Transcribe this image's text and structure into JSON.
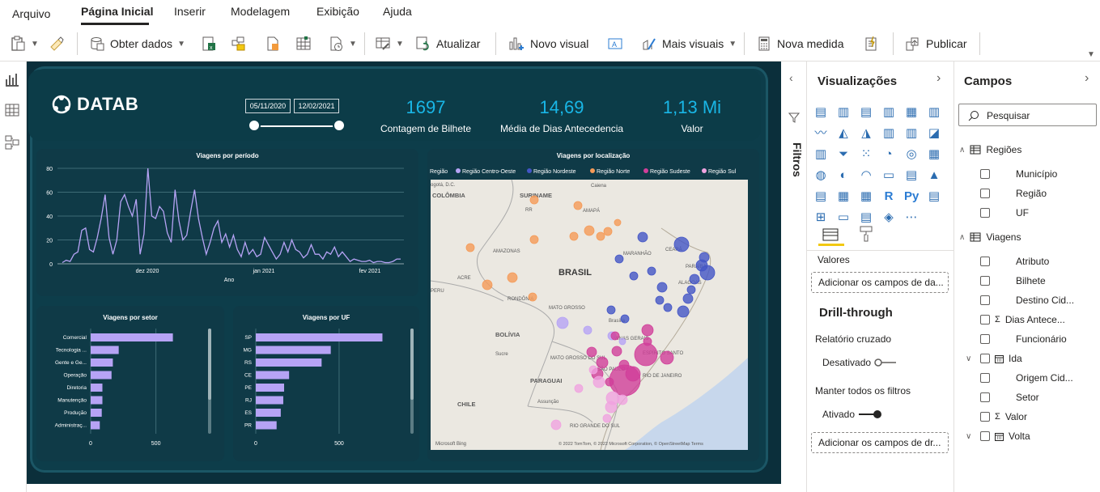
{
  "menu": {
    "items": [
      "Arquivo",
      "Página Inicial",
      "Inserir",
      "Modelagem",
      "Exibição",
      "Ajuda"
    ]
  },
  "ribbon": {
    "obter_dados": "Obter dados",
    "atualizar": "Atualizar",
    "novo_visual": "Novo visual",
    "mais_visuais": "Mais visuais",
    "nova_medida": "Nova medida",
    "publicar": "Publicar"
  },
  "report": {
    "logo": "DATAB",
    "date_start": "05/11/2020",
    "date_end": "12/02/2021",
    "kpis": [
      {
        "value": "1697",
        "label": "Contagem de Bilhete"
      },
      {
        "value": "14,69",
        "label": "Média de Dias Antecedencia"
      },
      {
        "value": "1,13 Mi",
        "label": "Valor"
      }
    ]
  },
  "chart_data": [
    {
      "type": "line",
      "title": "Viagens por período",
      "xlabel": "Ano",
      "ylabel": "",
      "ylim": [
        0,
        80
      ],
      "yticks": [
        0,
        20,
        40,
        60,
        80
      ],
      "xticks": [
        "dez 2020",
        "jan 2021",
        "fev 2021"
      ],
      "series": [
        {
          "values": [
            1,
            3,
            2,
            8,
            10,
            28,
            30,
            12,
            10,
            22,
            38,
            58,
            22,
            8,
            20,
            52,
            58,
            48,
            40,
            54,
            8,
            25,
            80,
            40,
            38,
            48,
            44,
            26,
            18,
            62,
            36,
            20,
            24,
            44,
            62,
            38,
            22,
            8,
            18,
            30,
            36,
            18,
            25,
            14,
            24,
            12,
            6,
            18,
            8,
            12,
            6,
            8,
            22,
            16,
            10,
            4,
            8,
            18,
            10,
            20,
            12,
            10,
            5,
            8,
            16,
            8,
            8,
            4,
            10,
            8,
            14,
            6,
            10,
            6,
            2,
            4,
            3,
            2,
            2,
            3,
            1,
            2,
            2,
            1,
            1,
            2,
            4,
            4
          ]
        }
      ],
      "color": "#b6a3f5"
    },
    {
      "type": "bar",
      "title": "Viagens por setor",
      "categories": [
        "Comercial",
        "Tecnologia ...",
        "Gente e Ge...",
        "Operação",
        "Diretoria",
        "Manutenção",
        "Produção",
        "Administraç..."
      ],
      "values": [
        630,
        215,
        170,
        160,
        90,
        90,
        85,
        70
      ],
      "xlim": [
        0,
        800
      ],
      "xticks": [
        0,
        500
      ],
      "color": "#b6a3f5"
    },
    {
      "type": "bar",
      "title": "Viagens por UF",
      "categories": [
        "SP",
        "MG",
        "RS",
        "CE",
        "PE",
        "RJ",
        "ES",
        "PR"
      ],
      "values": [
        760,
        450,
        395,
        200,
        170,
        165,
        150,
        125
      ],
      "xlim": [
        0,
        850
      ],
      "xticks": [
        0,
        500
      ],
      "color": "#b6a3f5"
    },
    {
      "type": "scatter",
      "title": "Viagens por localização",
      "legend_title": "Região",
      "series": [
        {
          "name": "Região Centro-Oeste",
          "color": "#b6a3f5"
        },
        {
          "name": "Região Nordeste",
          "color": "#4355c6"
        },
        {
          "name": "Região Norte",
          "color": "#f59a57"
        },
        {
          "name": "Região Sudeste",
          "color": "#d13f9a"
        },
        {
          "name": "Região Sul",
          "color": "#f0a3e0"
        }
      ],
      "map_labels": [
        "ogotá, D.C.",
        "COLÔMBIA",
        "SURINAME",
        "Caiena",
        "RR",
        "AMAPÁ",
        "AMAZONAS",
        "BRASIL",
        "ACRE",
        "RONDÔNIA",
        "MATO GROSSO",
        "PERU",
        "BOLÍVIA",
        "Sucre",
        "Brasília",
        "MINAS GERAIS",
        "ESPÍRITO SANTO",
        "MATO GROSSO DO SUL",
        "SÃO PAULO",
        "RIO DE JANEIRO",
        "PARAGUAI",
        "Assunção",
        "CHILE",
        "RIO GRANDE DO SUL",
        "CEARÁ",
        "PARAÍBA",
        "ALAGOAS",
        "MARANHÃO"
      ],
      "attribution": "© 2022 TomTom, © 2022 Microsoft Corporation, © OpenStreetMap Terms",
      "bing": "Microsoft Bing"
    }
  ],
  "filters_pane": {
    "label": "Filtros"
  },
  "viz_pane": {
    "title": "Visualizações",
    "values_label": "Valores",
    "add_fields": "Adicionar os campos de da...",
    "drill_title": "Drill-through",
    "cross_report": "Relatório cruzado",
    "cross_state": "Desativado",
    "keep_filters": "Manter todos os filtros",
    "keep_state": "Ativado",
    "add_drill": "Adicionar os campos de dr..."
  },
  "fields_pane": {
    "title": "Campos",
    "search_placeholder": "Pesquisar",
    "tables": [
      {
        "name": "Regiões",
        "fields": [
          "Município",
          "Região",
          "UF"
        ]
      },
      {
        "name": "Viagens",
        "fields": [
          "Atributo",
          "Bilhete",
          "Destino Cid...",
          "Dias Antece...",
          "Funcionário",
          "Ida",
          "Origem Cid...",
          "Setor",
          "Valor",
          "Volta"
        ]
      }
    ]
  },
  "colors": {
    "accent": "#19b6e6",
    "report_bg": "#0d3d4a",
    "bar": "#b6a3f5"
  }
}
